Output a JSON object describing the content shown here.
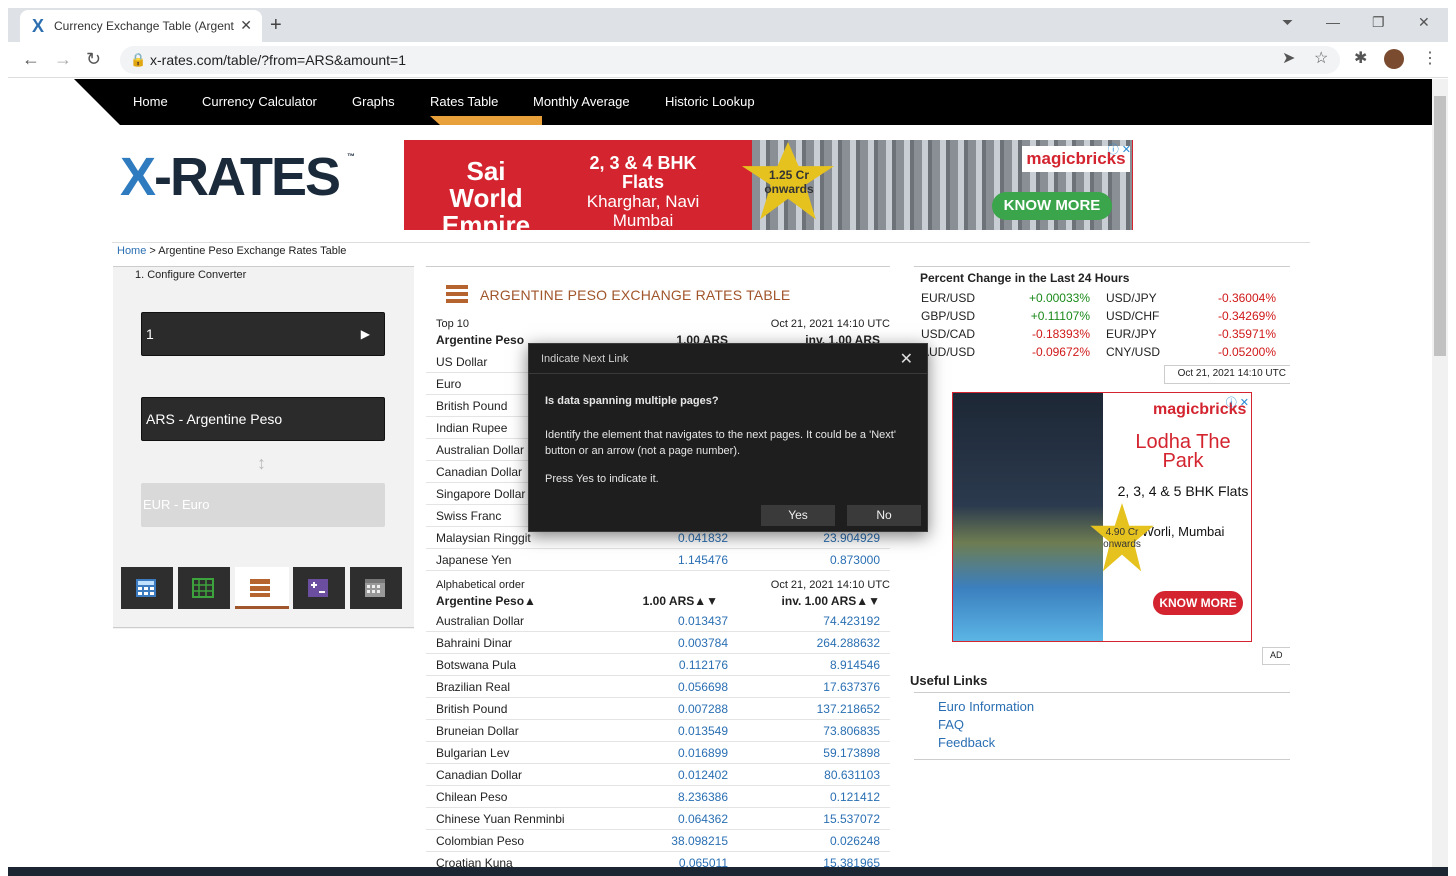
{
  "browser": {
    "tab_title": "Currency Exchange Table (Argent",
    "tab_favicon": "X",
    "url": "x-rates.com/table/?from=ARS&amount=1"
  },
  "site": {
    "nav": [
      "Home",
      "Currency Calculator",
      "Graphs",
      "Rates Table",
      "Monthly Average",
      "Historic Lookup"
    ],
    "logo_main": "-RATES",
    "logo_x": "X",
    "logo_tm": "™"
  },
  "ad_top": {
    "headline": "Sai World Empire",
    "flats": "2, 3 & 4 BHK Flats",
    "location": "Kharghar, Navi Mumbai",
    "price": "1.25 Cr onwards",
    "brand": "magicbricks",
    "cta": "KNOW MORE",
    "adchoice": "ⓘ ✕"
  },
  "breadcrumb": {
    "home": "Home",
    "rest": " > Argentine Peso Exchange Rates Table"
  },
  "converter": {
    "step_label": "1. Configure Converter",
    "amount": "1",
    "play": "▶",
    "from": "ARS - Argentine Peso",
    "swap": "↕",
    "to": "EUR - Euro"
  },
  "table": {
    "title": "ARGENTINE PESO EXCHANGE RATES TABLE",
    "top10_label": "Top 10",
    "timestamp": "Oct 21, 2021 14:10 UTC",
    "base_name": "Argentine Peso",
    "col1": "1.00 ARS",
    "col2": "inv. 1.00 ARS",
    "top10": [
      {
        "name": "US Dollar",
        "v1": "",
        "v2": ""
      },
      {
        "name": "Euro",
        "v1": "",
        "v2": ""
      },
      {
        "name": "British Pound",
        "v1": "",
        "v2": ""
      },
      {
        "name": "Indian Rupee",
        "v1": "",
        "v2": ""
      },
      {
        "name": "Australian Dollar",
        "v1": "",
        "v2": ""
      },
      {
        "name": "Canadian Dollar",
        "v1": "",
        "v2": ""
      },
      {
        "name": "Singapore Dollar",
        "v1": "",
        "v2": ""
      },
      {
        "name": "Swiss Franc",
        "v1": "",
        "v2": ""
      },
      {
        "name": "Malaysian Ringgit",
        "v1": "0.041832",
        "v2": "23.904929"
      },
      {
        "name": "Japanese Yen",
        "v1": "1.145476",
        "v2": "0.873000"
      }
    ],
    "alpha_label": "Alphabetical order",
    "alpha_base": "Argentine Peso▲",
    "alpha_col1": "1.00 ARS▲▼",
    "alpha_col2": "inv. 1.00 ARS▲▼",
    "alpha": [
      {
        "name": "Australian Dollar",
        "v1": "0.013437",
        "v2": "74.423192"
      },
      {
        "name": "Bahraini Dinar",
        "v1": "0.003784",
        "v2": "264.288632"
      },
      {
        "name": "Botswana Pula",
        "v1": "0.112176",
        "v2": "8.914546"
      },
      {
        "name": "Brazilian Real",
        "v1": "0.056698",
        "v2": "17.637376"
      },
      {
        "name": "British Pound",
        "v1": "0.007288",
        "v2": "137.218652"
      },
      {
        "name": "Bruneian Dollar",
        "v1": "0.013549",
        "v2": "73.806835"
      },
      {
        "name": "Bulgarian Lev",
        "v1": "0.016899",
        "v2": "59.173898"
      },
      {
        "name": "Canadian Dollar",
        "v1": "0.012402",
        "v2": "80.631103"
      },
      {
        "name": "Chilean Peso",
        "v1": "8.236386",
        "v2": "0.121412"
      },
      {
        "name": "Chinese Yuan Renminbi",
        "v1": "0.064362",
        "v2": "15.537072"
      },
      {
        "name": "Colombian Peso",
        "v1": "38.098215",
        "v2": "0.026248"
      },
      {
        "name": "Croatian Kuna",
        "v1": "0.065011",
        "v2": "15.381965"
      }
    ]
  },
  "percent_change": {
    "title": "Percent Change in the Last 24 Hours",
    "timestamp": "Oct 21, 2021 14:10 UTC",
    "left": [
      {
        "pair": "EUR/USD",
        "val": "+0.00033%",
        "dir": "up"
      },
      {
        "pair": "GBP/USD",
        "val": "+0.11107%",
        "dir": "up"
      },
      {
        "pair": "USD/CAD",
        "val": "-0.18393%",
        "dir": "down"
      },
      {
        "pair": "AUD/USD",
        "val": "-0.09672%",
        "dir": "down"
      }
    ],
    "right": [
      {
        "pair": "USD/JPY",
        "val": "-0.36004%",
        "dir": "down"
      },
      {
        "pair": "USD/CHF",
        "val": "-0.34269%",
        "dir": "down"
      },
      {
        "pair": "EUR/JPY",
        "val": "-0.35971%",
        "dir": "down"
      },
      {
        "pair": "CNY/USD",
        "val": "-0.05200%",
        "dir": "down"
      }
    ]
  },
  "ad_side": {
    "brand": "magicbricks",
    "title": "Lodha The Park",
    "flats": "2, 3, 4 & 5 BHK Flats",
    "location": "Worli, Mumbai",
    "price": "4.90 Cr onwards",
    "cta": "KNOW MORE",
    "ad_label": "AD",
    "adchoice": "ⓘ ✕"
  },
  "useful_links": {
    "title": "Useful Links",
    "items": [
      "Euro Information",
      "FAQ",
      "Feedback"
    ]
  },
  "dialog": {
    "title": "Indicate Next Link",
    "question": "Is data spanning multiple pages?",
    "body": "Identify the element that navigates to the next pages. It could be a 'Next' button or an arrow (not a page number).",
    "instruction": "Press Yes to indicate it.",
    "yes": "Yes",
    "no": "No"
  },
  "colors": {
    "accent_orange": "#e8a03a",
    "title_brown": "#a0552b",
    "link_blue": "#2a6fb3",
    "up_green": "#1a8a1a",
    "down_red": "#d01919"
  }
}
